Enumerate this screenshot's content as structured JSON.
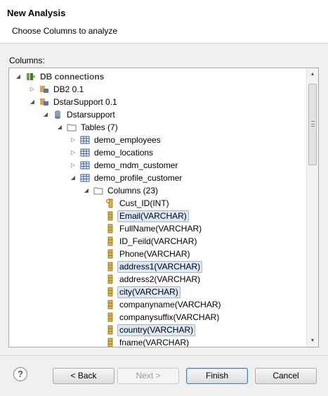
{
  "dialog": {
    "title": "New Analysis",
    "subtitle": "Choose Columns to analyze",
    "section_label": "Columns:"
  },
  "tree": {
    "root": "DB connections",
    "db2": "DB2 0.1",
    "dstar": "DstarSupport 0.1",
    "schema": "Dstarsupport",
    "tables_folder": "Tables (7)",
    "tables": [
      "demo_employees",
      "demo_locations",
      "demo_mdm_customer",
      "demo_profile_customer"
    ],
    "columns_folder": "Columns (23)",
    "columns": [
      {
        "label": "Cust_ID(INT)",
        "selected": false,
        "key": true
      },
      {
        "label": "Email(VARCHAR)",
        "selected": true
      },
      {
        "label": "FullName(VARCHAR)",
        "selected": false
      },
      {
        "label": "ID_Feild(VARCHAR)",
        "selected": false
      },
      {
        "label": "Phone(VARCHAR)",
        "selected": false
      },
      {
        "label": "address1(VARCHAR)",
        "selected": true
      },
      {
        "label": "address2(VARCHAR)",
        "selected": false
      },
      {
        "label": "city(VARCHAR)",
        "selected": true
      },
      {
        "label": "companyname(VARCHAR)",
        "selected": false
      },
      {
        "label": "companysuffix(VARCHAR)",
        "selected": false
      },
      {
        "label": "country(VARCHAR)",
        "selected": true
      },
      {
        "label": "fname(VARCHAR)",
        "selected": false
      }
    ]
  },
  "buttons": {
    "help": "?",
    "back": "< Back",
    "next": "Next >",
    "finish": "Finish",
    "cancel": "Cancel"
  },
  "colors": {
    "selection_bg": "#dbe8f7",
    "selection_border": "#9ab8dc",
    "default_button_border": "#3c7fb1"
  }
}
